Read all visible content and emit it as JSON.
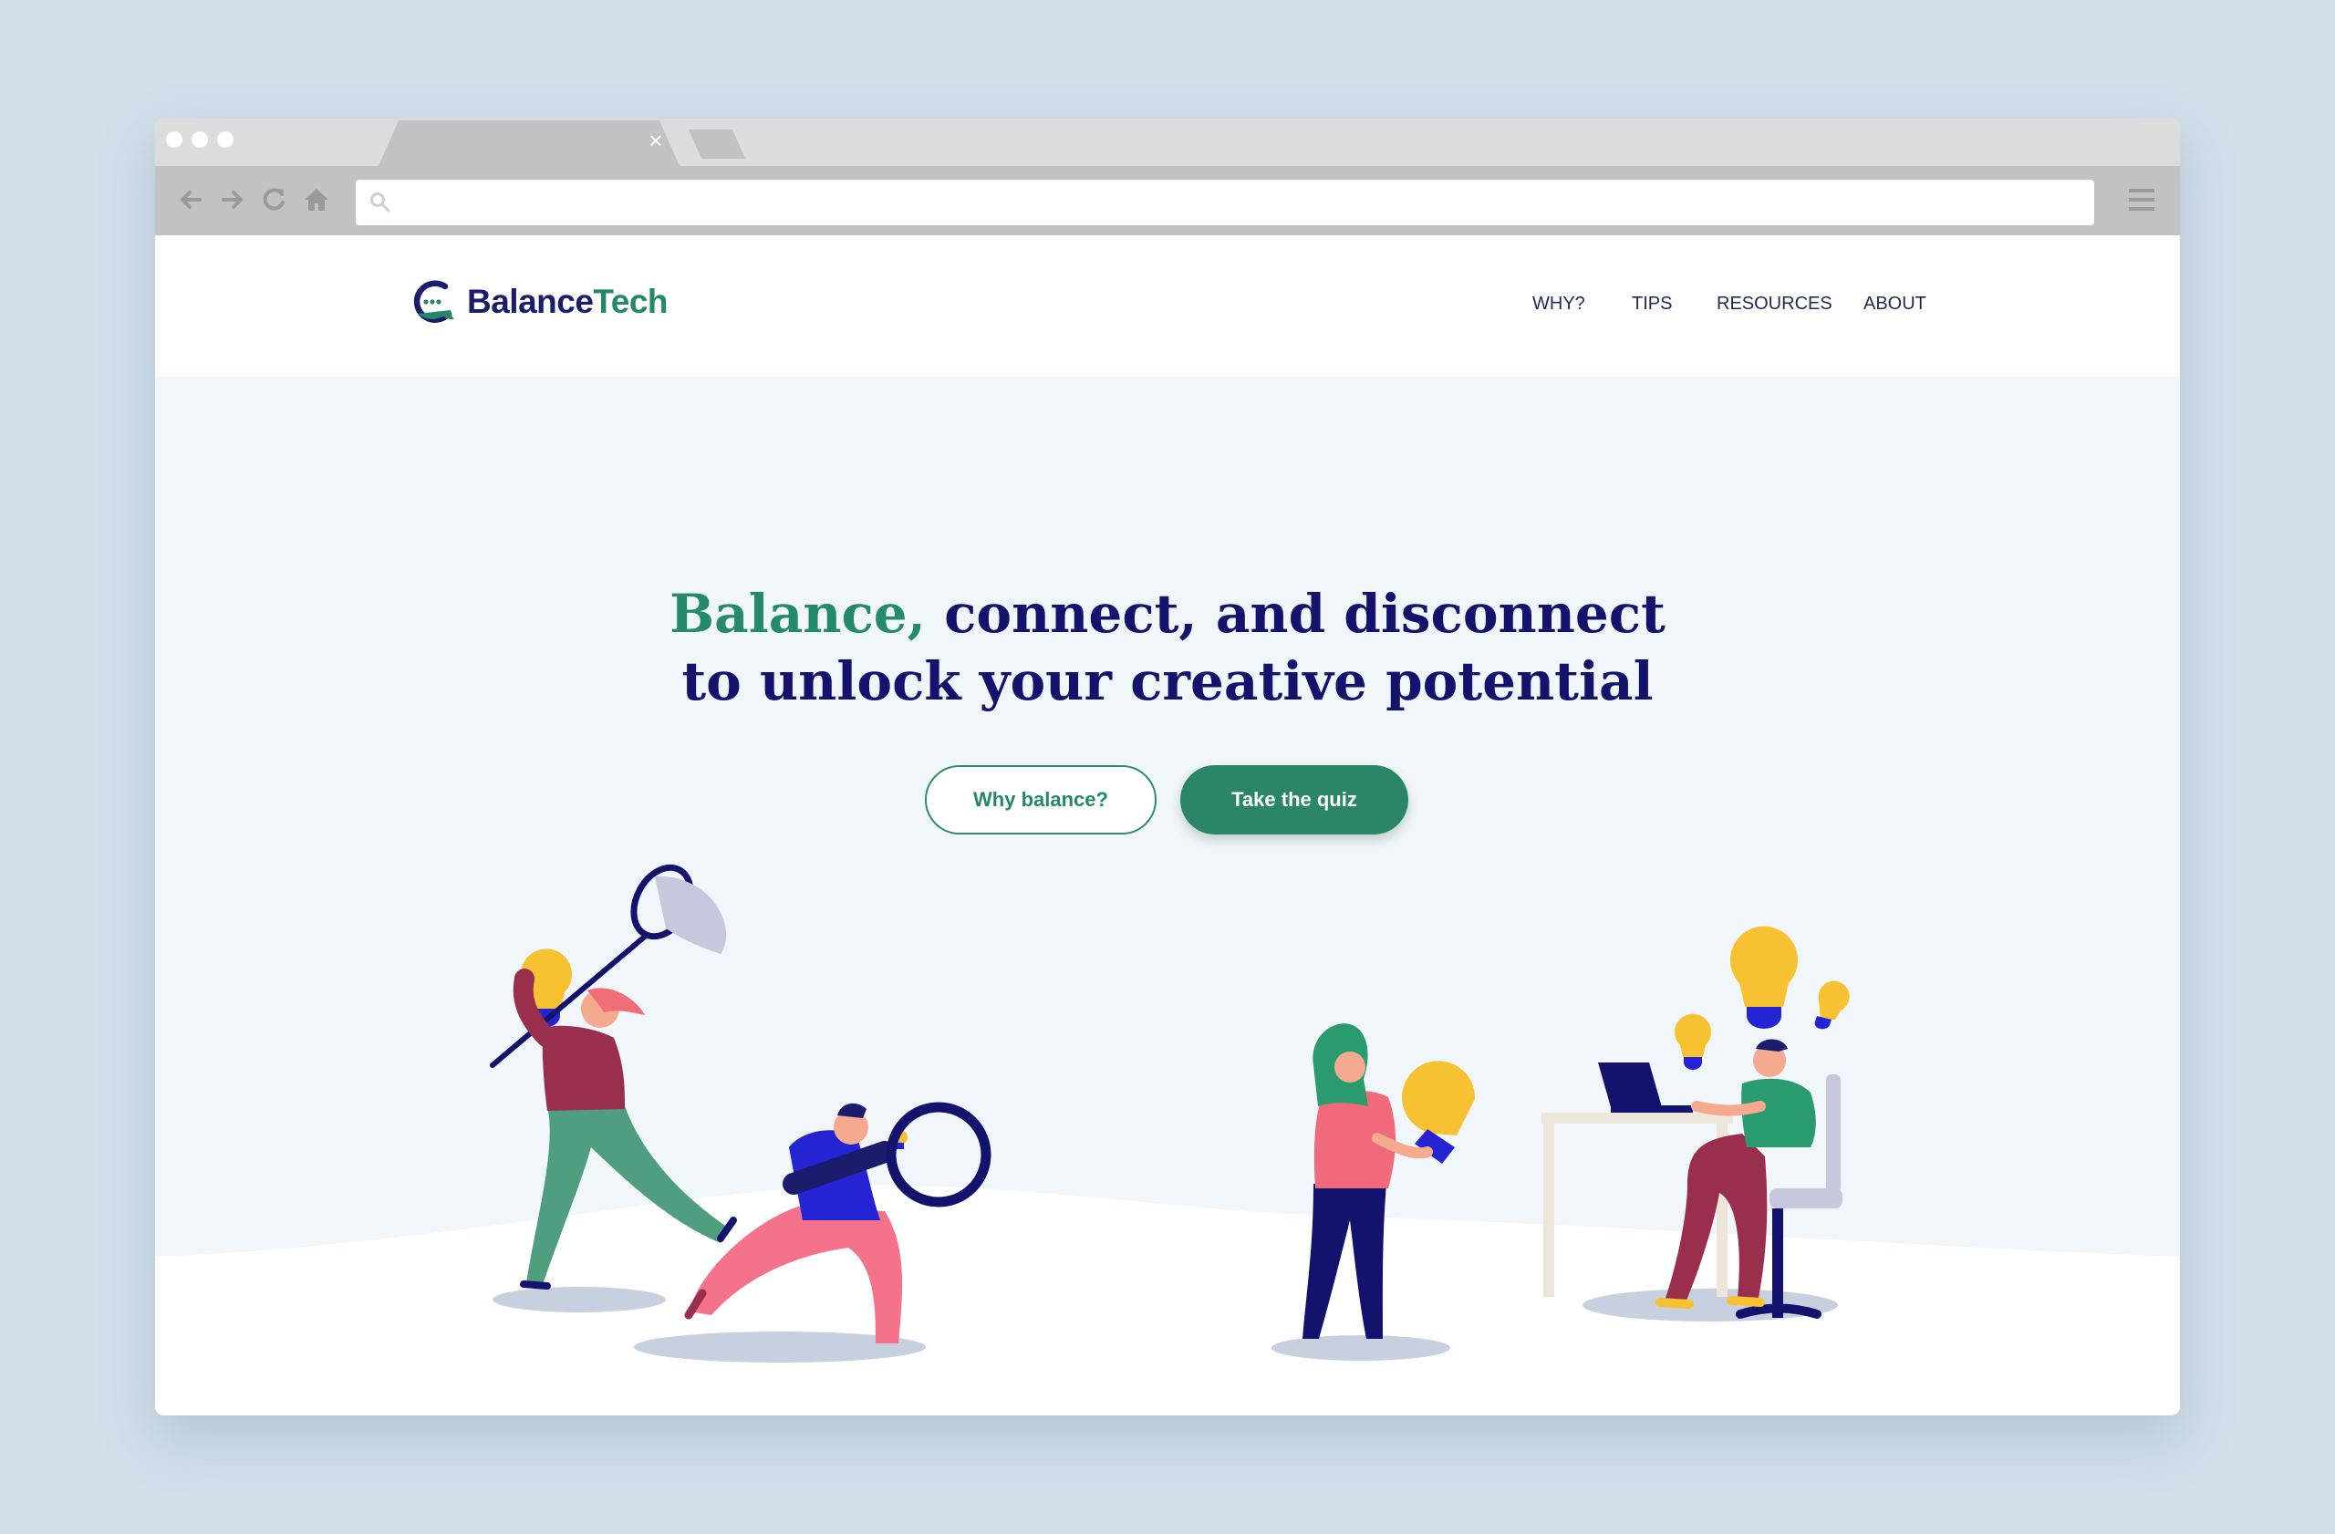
{
  "browser": {
    "tab_close": "×"
  },
  "site": {
    "logo_part1": "Balance",
    "logo_part2": "Tech",
    "nav": [
      {
        "label": "WHY?"
      },
      {
        "label": "TIPS"
      },
      {
        "label": "RESOURCES"
      },
      {
        "label": "ABOUT"
      }
    ]
  },
  "hero": {
    "title_accent": "Balance,",
    "title_line1_rest": " connect, and disconnect",
    "title_line2": "to unlock your creative potential",
    "primary_button": "Take the quiz",
    "secondary_button": "Why balance?"
  },
  "colors": {
    "brand_green": "#24876a",
    "brand_navy": "#13136e",
    "page_background": "#d1dfeb",
    "hero_background": "#f1f6fa"
  },
  "icons": [
    "back-arrow-icon",
    "forward-arrow-icon",
    "reload-icon",
    "home-icon",
    "search-icon",
    "hamburger-menu-icon",
    "close-icon",
    "logo-icon"
  ]
}
